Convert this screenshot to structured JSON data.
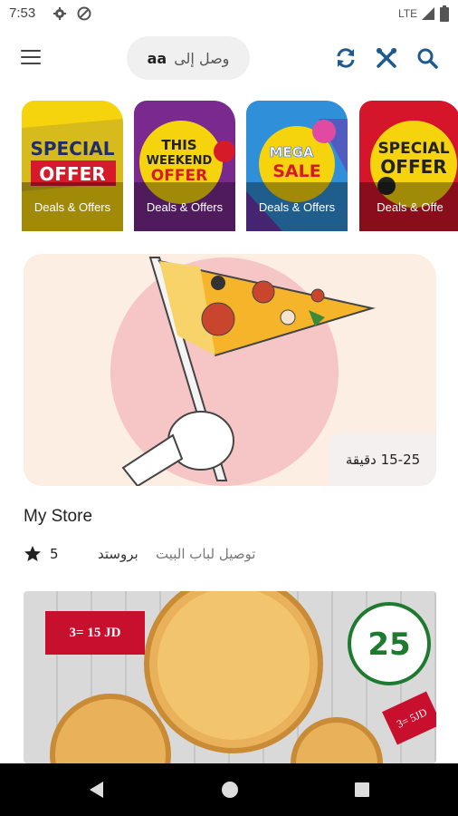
{
  "status_bar": {
    "time": "7:53",
    "network": "LTE"
  },
  "header": {
    "deliver_label": "وصل إلى",
    "location": "aa"
  },
  "banners": [
    {
      "caption": "Deals & Offers",
      "art_text": [
        "SPECIAL",
        "OFFER"
      ],
      "bg": "#f5d20a"
    },
    {
      "caption": "Deals & Offers",
      "art_text": [
        "THIS",
        "WEEKEND",
        "OFFER"
      ],
      "bg": "#7a2a8e"
    },
    {
      "caption": "Deals & Offers",
      "art_text": [
        "MEGA",
        "SALE"
      ],
      "bg": "#2f8fd8"
    },
    {
      "caption": "Deals & Offe",
      "art_text": [
        "SPECIAL",
        "OFFER"
      ],
      "bg": "#d4152a"
    }
  ],
  "stores": [
    {
      "name": "My Store",
      "eta": "15-25 دقيقة",
      "rating": "5",
      "tags": [
        "بروستد",
        "توصيل لباب البيت"
      ]
    }
  ],
  "promo": {
    "price_1": "3= 15 JD",
    "price_2": "3= 5JD"
  }
}
